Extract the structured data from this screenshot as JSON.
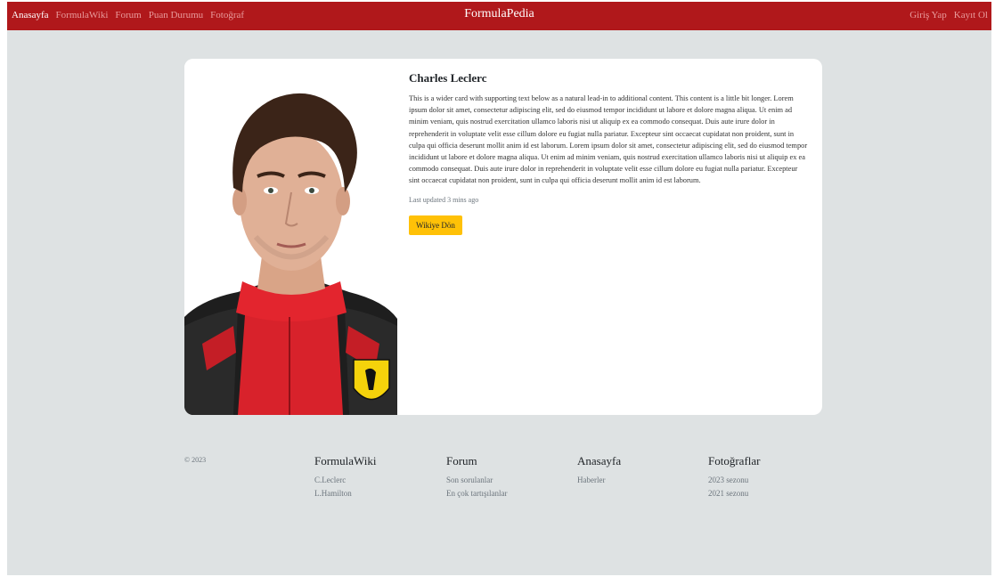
{
  "navbar": {
    "links": [
      "Anasayfa",
      "FormulaWiki",
      "Forum",
      "Puan Durumu",
      "Fotoğraf"
    ],
    "brand": "FormulaPedia",
    "right_links": [
      "Giriş Yap",
      "Kayıt Ol"
    ],
    "background_color": "#b0181b"
  },
  "card": {
    "title": "Charles Leclerc",
    "text": "This is a wider card with supporting text below as a natural lead-in to additional content. This content is a little bit longer. Lorem ipsum dolor sit amet, consectetur adipiscing elit, sed do eiusmod tempor incididunt ut labore et dolore magna aliqua. Ut enim ad minim veniam, quis nostrud exercitation ullamco laboris nisi ut aliquip ex ea commodo consequat. Duis aute irure dolor in reprehenderit in voluptate velit esse cillum dolore eu fugiat nulla pariatur. Excepteur sint occaecat cupidatat non proident, sunt in culpa qui officia deserunt mollit anim id est laborum. Lorem ipsum dolor sit amet, consectetur adipiscing elit, sed do eiusmod tempor incididunt ut labore et dolore magna aliqua. Ut enim ad minim veniam, quis nostrud exercitation ullamco laboris nisi ut aliquip ex ea commodo consequat. Duis aute irure dolor in reprehenderit in voluptate velit esse cillum dolore eu fugiat nulla pariatur. Excepteur sint occaecat cupidatat non proident, sunt in culpa qui officia deserunt mollit anim id est laborum.",
    "updated": "Last updated 3 mins ago",
    "button_label": "Wikiye Dön",
    "button_color": "#ffc107"
  },
  "footer": {
    "copyright": "© 2023",
    "columns": [
      {
        "title": "FormulaWiki",
        "links": [
          "C.Leclerc",
          "L.Hamilton"
        ]
      },
      {
        "title": "Forum",
        "links": [
          "Son sorulanlar",
          "En çok tartışılanlar"
        ]
      },
      {
        "title": "Anasayfa",
        "links": [
          "Haberler"
        ]
      },
      {
        "title": "Fotoğraflar",
        "links": [
          "2023 sezonu",
          "2021 sezonu"
        ]
      }
    ]
  }
}
